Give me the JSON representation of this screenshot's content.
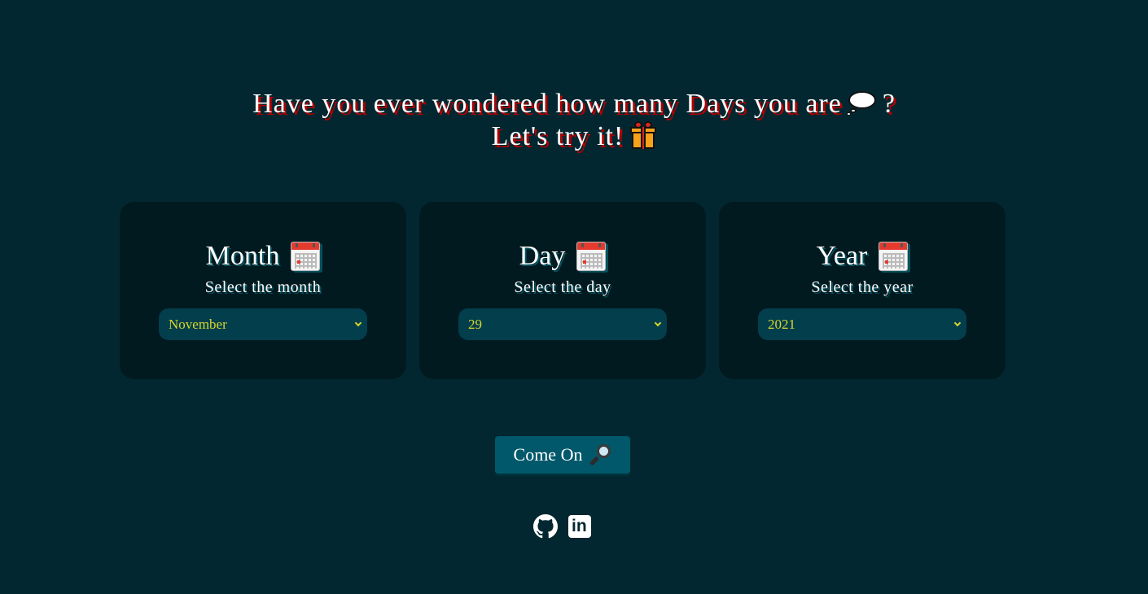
{
  "heading": {
    "line1_text": "Have you ever wondered how many Days you are",
    "line1_suffix": "?",
    "line2_text": "Let's try it!"
  },
  "cards": [
    {
      "title": "Month",
      "subtitle": "Select the month",
      "selected": "November"
    },
    {
      "title": "Day",
      "subtitle": "Select the day",
      "selected": "29"
    },
    {
      "title": "Year",
      "subtitle": "Select the year",
      "selected": "2021"
    }
  ],
  "submit": {
    "label": "Come On"
  },
  "footer": {
    "links": [
      "github-icon",
      "linkedin-icon"
    ]
  },
  "colors": {
    "background": "#032730",
    "card": "#011a20",
    "select_bg": "#033e4d",
    "select_text": "#d6d62c",
    "button": "#02586b",
    "heading_shadow": "#b30000"
  }
}
